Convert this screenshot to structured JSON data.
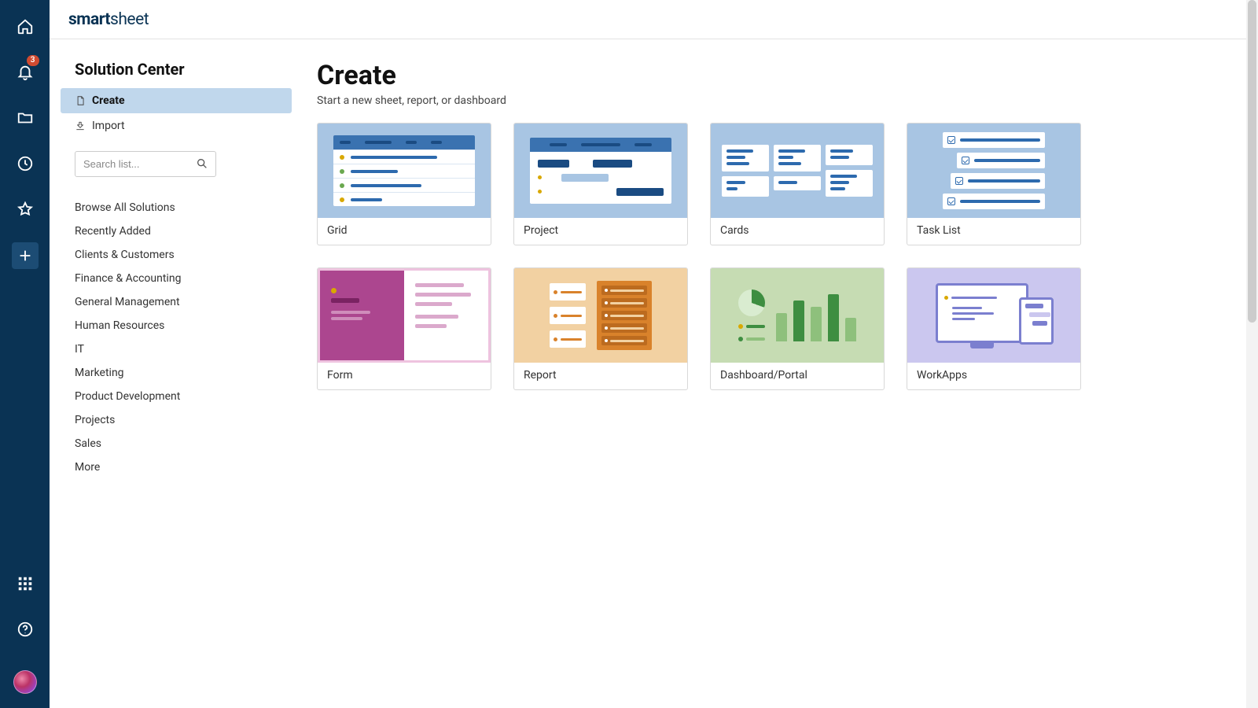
{
  "brand": {
    "bold": "smart",
    "light": "sheet"
  },
  "rail": {
    "notification_count": "3"
  },
  "side": {
    "title": "Solution Center",
    "nav": {
      "create": "Create",
      "import": "Import"
    },
    "search_placeholder": "Search list...",
    "cats": [
      "Browse All Solutions",
      "Recently Added",
      "Clients & Customers",
      "Finance & Accounting",
      "General Management",
      "Human Resources",
      "IT",
      "Marketing",
      "Product Development",
      "Projects",
      "Sales",
      "More"
    ]
  },
  "page": {
    "title": "Create",
    "subtitle": "Start a new sheet, report, or dashboard"
  },
  "tiles": {
    "grid": "Grid",
    "project": "Project",
    "cards": "Cards",
    "task_list": "Task List",
    "form": "Form",
    "report": "Report",
    "dashboard": "Dashboard/Portal",
    "workapps": "WorkApps"
  }
}
